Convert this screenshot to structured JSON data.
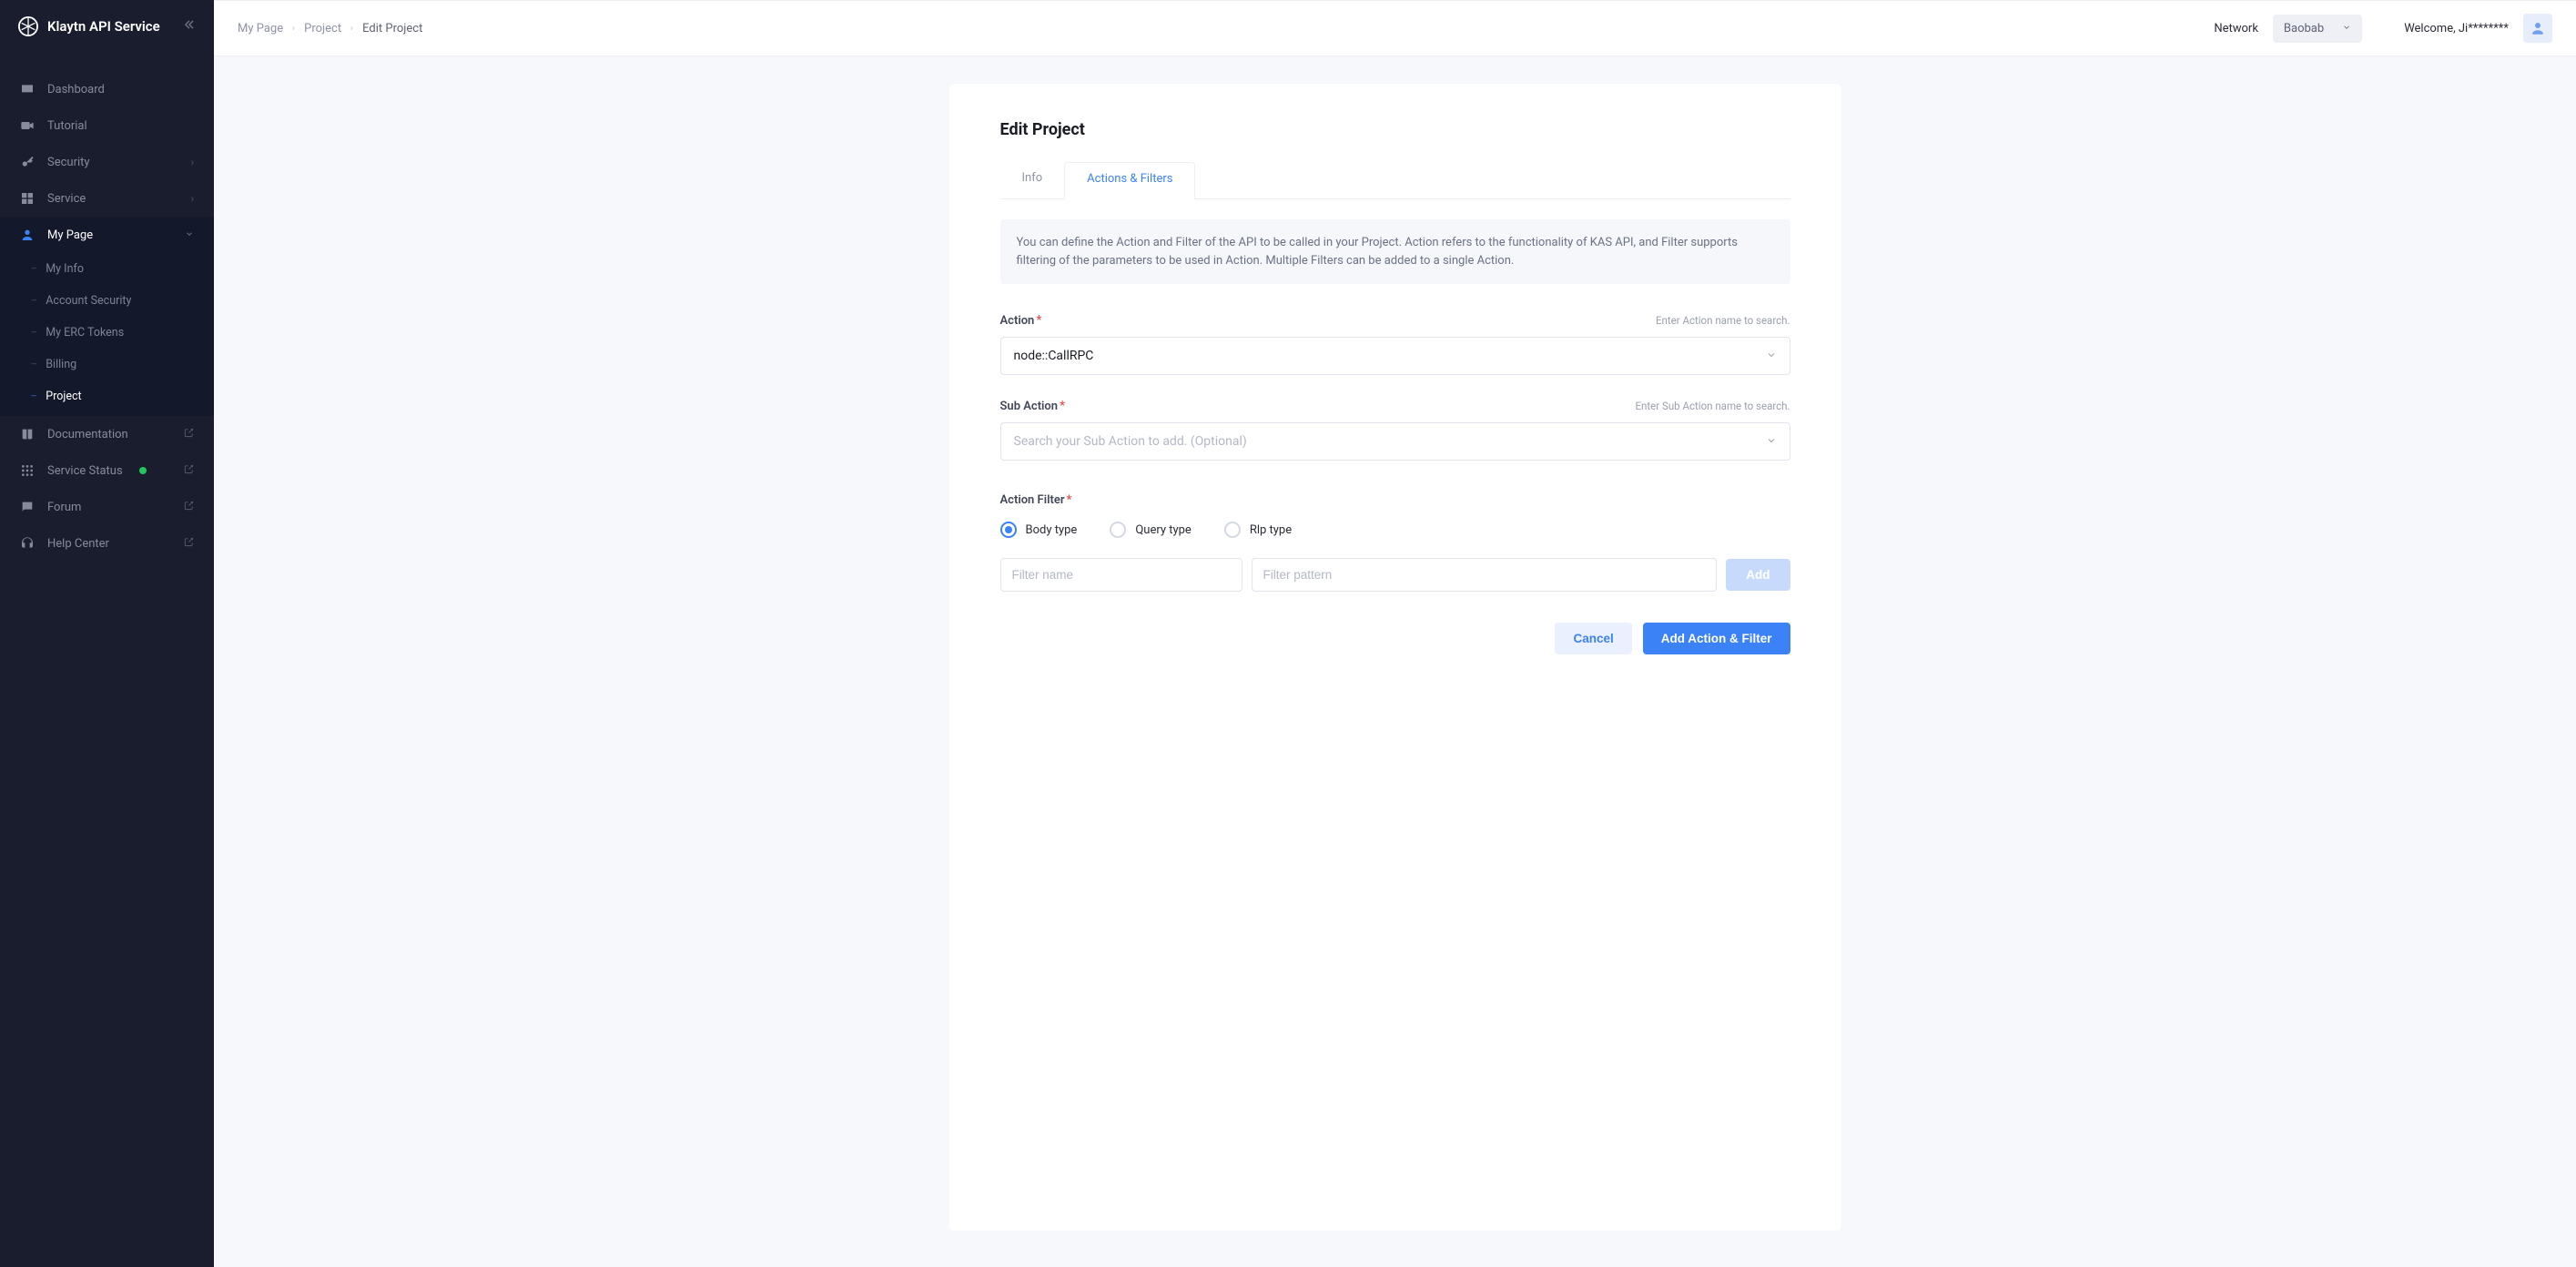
{
  "brand": "Klaytn API Service",
  "sidebar": {
    "items": [
      {
        "label": "Dashboard"
      },
      {
        "label": "Tutorial"
      },
      {
        "label": "Security"
      },
      {
        "label": "Service"
      },
      {
        "label": "My Page"
      },
      {
        "label": "Documentation"
      },
      {
        "label": "Service Status"
      },
      {
        "label": "Forum"
      },
      {
        "label": "Help Center"
      }
    ],
    "mypage_sub": [
      {
        "label": "My Info"
      },
      {
        "label": "Account Security"
      },
      {
        "label": "My ERC Tokens"
      },
      {
        "label": "Billing"
      },
      {
        "label": "Project"
      }
    ]
  },
  "breadcrumbs": [
    "My Page",
    "Project",
    "Edit Project"
  ],
  "topbar": {
    "network_label": "Network",
    "network_value": "Baobab",
    "welcome": "Welcome, Ji********"
  },
  "page": {
    "title": "Edit Project",
    "tabs": [
      "Info",
      "Actions & Filters"
    ],
    "info_text": "You can define the Action and Filter of the API to be called in your Project. Action refers to the functionality of KAS API, and Filter supports filtering of the parameters to be used in Action. Multiple Filters can be added to a single Action.",
    "action": {
      "label": "Action",
      "hint": "Enter Action name to search.",
      "value": "node::CallRPC"
    },
    "sub_action": {
      "label": "Sub Action",
      "hint": "Enter Sub Action name to search.",
      "placeholder": "Search your Sub Action to add. (Optional)"
    },
    "action_filter": {
      "label": "Action Filter",
      "radios": [
        "Body type",
        "Query type",
        "Rlp type"
      ],
      "name_placeholder": "Filter name",
      "pattern_placeholder": "Filter pattern",
      "add_btn": "Add"
    },
    "buttons": {
      "cancel": "Cancel",
      "submit": "Add Action & Filter"
    }
  }
}
